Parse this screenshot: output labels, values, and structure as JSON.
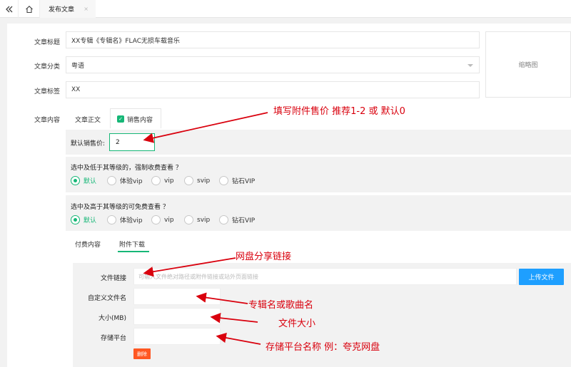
{
  "topbar": {
    "back_icon": "double-chevron-left-icon",
    "home_icon": "home-icon",
    "tab_label": "发布文章",
    "tab_close": "×"
  },
  "form": {
    "title_label": "文章标题",
    "title_value": "XX专辑《专辑名》FLAC无损车载音乐",
    "category_label": "文章分类",
    "category_value": "粤语",
    "tags_label": "文章标签",
    "tags_value": "XX",
    "content_label": "文章内容",
    "thumbnail_label": "缩略图"
  },
  "content_tabs": {
    "body": "文章正文",
    "sales": "销售内容"
  },
  "sales": {
    "price_label": "默认销售价:",
    "price_value": "2",
    "paid_question": "选中及低于其等级的，强制收费查看 ？",
    "free_question": "选中及高于其等级的可免费查看 ？",
    "levels": [
      "默认",
      "体验vip",
      "vip",
      "svip",
      "钻石VIP"
    ],
    "paid_selected": "默认",
    "free_selected": "默认"
  },
  "sub_tabs": {
    "paid_content": "付费内容",
    "attachment": "附件下载"
  },
  "attachment": {
    "link_label": "文件链接",
    "link_placeholder": "可输入文件绝对路径或附件链接或站外页面链接",
    "name_label": "自定义文件名",
    "size_label": "大小(MB)",
    "platform_label": "存储平台",
    "upload_button": "上传文件",
    "delete_button": "删除"
  },
  "annotations": {
    "price_hint": "填写附件售价 推荐1-2 或 默认0",
    "link_hint": "网盘分享链接",
    "name_hint": "专辑名或歌曲名",
    "size_hint": "文件大小",
    "platform_hint": "存储平台名称 例：夸克网盘"
  },
  "colors": {
    "accent": "#16b777",
    "upload": "#1e9fff",
    "danger": "#ff5722",
    "annotation": "#d9000d"
  }
}
